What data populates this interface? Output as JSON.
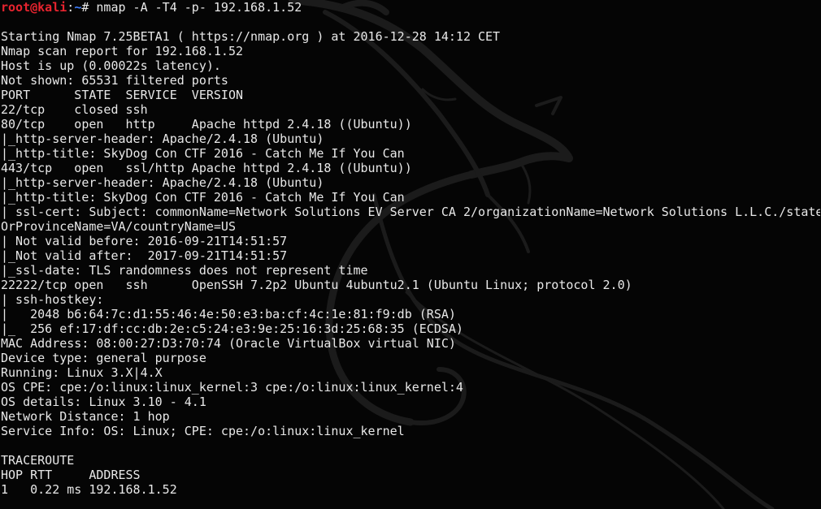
{
  "colors": {
    "background": "#050505",
    "text": "#e8e8e8",
    "prompt_user": "#e8242f",
    "prompt_path": "#3f7fff",
    "watermark": "#1b1b1b"
  },
  "watermark_icon": "kali-dragon-icon",
  "prompt": {
    "user_host": "root@kali",
    "separator": ":",
    "path": "~",
    "symbol": "# ",
    "command": "nmap -A -T4 -p- 192.168.1.52"
  },
  "output_lines": [
    "",
    "Starting Nmap 7.25BETA1 ( https://nmap.org ) at 2016-12-28 14:12 CET",
    "Nmap scan report for 192.168.1.52",
    "Host is up (0.00022s latency).",
    "Not shown: 65531 filtered ports",
    "PORT      STATE  SERVICE  VERSION",
    "22/tcp    closed ssh",
    "80/tcp    open   http     Apache httpd 2.4.18 ((Ubuntu))",
    "|_http-server-header: Apache/2.4.18 (Ubuntu)",
    "|_http-title: SkyDog Con CTF 2016 - Catch Me If You Can",
    "443/tcp   open   ssl/http Apache httpd 2.4.18 ((Ubuntu))",
    "|_http-server-header: Apache/2.4.18 (Ubuntu)",
    "|_http-title: SkyDog Con CTF 2016 - Catch Me If You Can",
    "| ssl-cert: Subject: commonName=Network Solutions EV Server CA 2/organizationName=Network Solutions L.L.C./state",
    "OrProvinceName=VA/countryName=US",
    "| Not valid before: 2016-09-21T14:51:57",
    "|_Not valid after:  2017-09-21T14:51:57",
    "|_ssl-date: TLS randomness does not represent time",
    "22222/tcp open   ssh      OpenSSH 7.2p2 Ubuntu 4ubuntu2.1 (Ubuntu Linux; protocol 2.0)",
    "| ssh-hostkey:",
    "|   2048 b6:64:7c:d1:55:46:4e:50:e3:ba:cf:4c:1e:81:f9:db (RSA)",
    "|_  256 ef:17:df:cc:db:2e:c5:24:e3:9e:25:16:3d:25:68:35 (ECDSA)",
    "MAC Address: 08:00:27:D3:70:74 (Oracle VirtualBox virtual NIC)",
    "Device type: general purpose",
    "Running: Linux 3.X|4.X",
    "OS CPE: cpe:/o:linux:linux_kernel:3 cpe:/o:linux:linux_kernel:4",
    "OS details: Linux 3.10 - 4.1",
    "Network Distance: 1 hop",
    "Service Info: OS: Linux; CPE: cpe:/o:linux:linux_kernel",
    "",
    "TRACEROUTE",
    "HOP RTT     ADDRESS",
    "1   0.22 ms 192.168.1.52"
  ]
}
